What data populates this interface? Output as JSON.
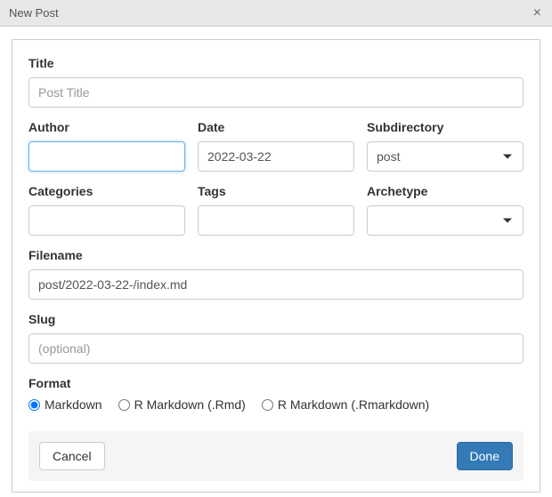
{
  "window": {
    "title": "New Post"
  },
  "fields": {
    "title": {
      "label": "Title",
      "placeholder": "Post Title",
      "value": ""
    },
    "author": {
      "label": "Author",
      "value": ""
    },
    "date": {
      "label": "Date",
      "value": "2022-03-22"
    },
    "subdirectory": {
      "label": "Subdirectory",
      "value": "post"
    },
    "categories": {
      "label": "Categories",
      "value": ""
    },
    "tags": {
      "label": "Tags",
      "value": ""
    },
    "archetype": {
      "label": "Archetype",
      "value": ""
    },
    "filename": {
      "label": "Filename",
      "value": "post/2022-03-22-/index.md"
    },
    "slug": {
      "label": "Slug",
      "placeholder": "(optional)",
      "value": ""
    },
    "format": {
      "label": "Format",
      "options": [
        "Markdown",
        "R Markdown (.Rmd)",
        "R Markdown (.Rmarkdown)"
      ],
      "selected": "Markdown"
    }
  },
  "buttons": {
    "cancel": "Cancel",
    "done": "Done"
  }
}
